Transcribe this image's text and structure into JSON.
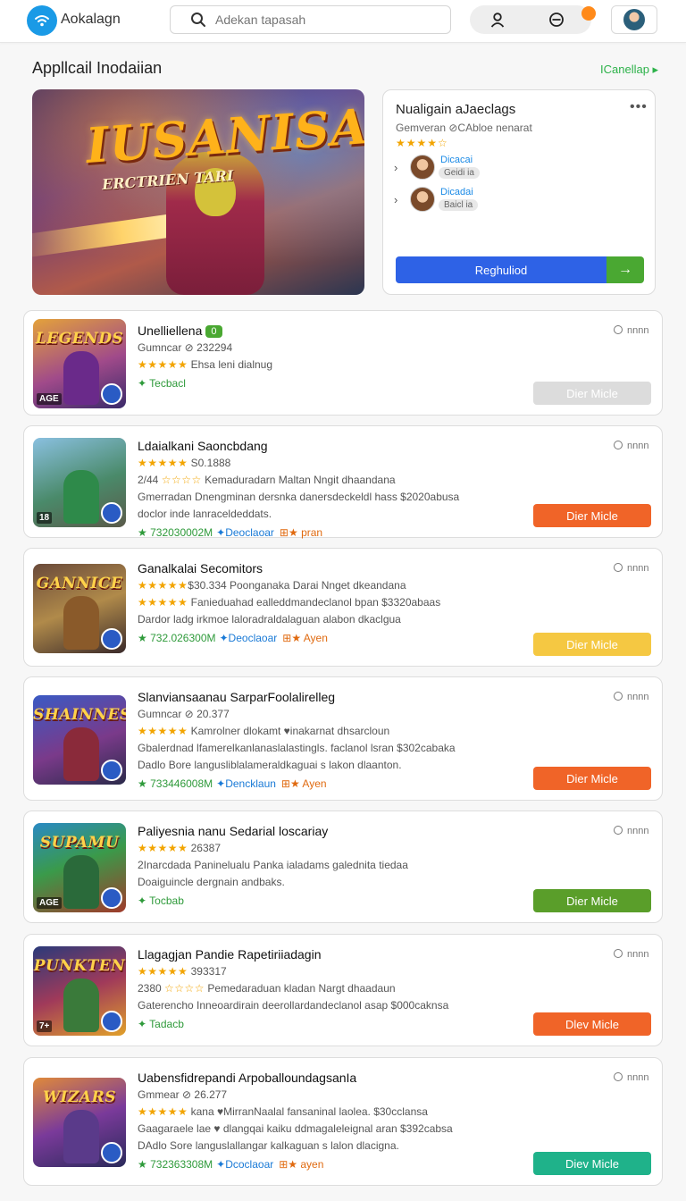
{
  "header": {
    "app_name": "Aokalagn",
    "search_placeholder": "Adekan tapasah"
  },
  "section": {
    "title": "Appllcail Inodaiian",
    "link": "ICanellap ▸"
  },
  "hero": {
    "title": "IUSANISA",
    "subtitle": "ERCTRIEN TARI"
  },
  "panel": {
    "title": "Nualigain aJaeclags",
    "subtitle": "Gemveran ⊘CAbloe nenarat",
    "stars": "★★★★☆",
    "friends": [
      {
        "name": "Dicacai",
        "tag": "Geidi ia"
      },
      {
        "name": "Dicadai",
        "tag": "Baicl ia"
      }
    ],
    "register_label": "Reghuliod",
    "go_label": "→"
  },
  "apps": [
    {
      "title": "Unelliellena",
      "badge": "0",
      "lines": [
        {
          "text": "Gumncar ⊘ 232294"
        },
        {
          "stars": "★★★★★",
          "text": " Ehsa leni dialnug"
        }
      ],
      "meta_plain": "✦ Tecbacl",
      "time": "nnnn",
      "action": "Dier Micle",
      "action_color": "#dcdcdc",
      "thumb_title": "LEGENDS",
      "thumb_bg": "linear-gradient(160deg,#e4a23a,#a04a8a 55%,#3a2a6a)",
      "fig_color": "#6a2a8a",
      "corner": "AGE"
    },
    {
      "title": "Ldaialkani Saoncbdang",
      "lines": [
        {
          "stars": "★★★★★",
          "text": " S0.1888"
        },
        {
          "text": "2/44 ",
          "stars2": "☆☆☆☆",
          "text2": " Kemaduradarn Maltan Nngit dhaandana"
        },
        {
          "text": "Gmerradan Dnengminan dersnka danersdeckeldl hass $2020abusa"
        },
        {
          "text": "doclor inde lanraceldeddats."
        }
      ],
      "meta": {
        "size": "★ 732030002M",
        "dl": "✦Deoclaoar",
        "tag": "⊞★ pran"
      },
      "time": "nnnn",
      "action": "Dier Micle",
      "action_color": "#f06428",
      "thumb_title": "",
      "thumb_bg": "linear-gradient(160deg,#8ac0e0,#4a8a6a 55%,#5a5a4a)",
      "fig_color": "#2e8a4a",
      "corner": "18"
    },
    {
      "title": "Ganalkalai Secomitors",
      "lines": [
        {
          "stars": "★★★★★",
          "text": "$30.334 Poonganaka Darai Nnget dkeandana"
        },
        {
          "stars": "★★★★★",
          "text": " Fanieduahad ealleddmandeclanol bpan $3320abaas"
        },
        {
          "text": "Dardor ladg irkmoe laloradraldalaguan alabon dkaclgua"
        }
      ],
      "meta": {
        "size": "★ 732.026300M",
        "dl": "✦Deoclaoar",
        "tag": "⊞★ Ayen"
      },
      "time": "nnnn",
      "action": "Dier Micle",
      "action_color": "#f5c842",
      "thumb_title": "GANNICE",
      "thumb_bg": "linear-gradient(160deg,#6a4a3a,#b08a4a 50%,#3a2a2a)",
      "fig_color": "#8a5a2a",
      "corner": ""
    },
    {
      "title": "Slanviansaanau SarparFoolalirelleg",
      "lines": [
        {
          "text": "Gumncar ⊘ 20.377"
        },
        {
          "stars": "★★★★★",
          "text": " Kamrolner dlokamt ♥inakarnat dhsarcloun"
        },
        {
          "text": "Gbalerdnad lfamerelkanlanaslalastingls. faclanol lsran $302cabaka"
        },
        {
          "text": "Dadlo Bore langusliblalameraldkaguai s lakon dlaanton."
        }
      ],
      "meta": {
        "size": "★ 733446008M",
        "dl": "✦Dencklaun",
        "tag": "⊞★ Ayen"
      },
      "time": "nnnn",
      "action": "Dier Micle",
      "action_color": "#f06428",
      "thumb_title": "SHAINNES",
      "thumb_bg": "linear-gradient(160deg,#3a5ac4,#7a3a8a 55%,#2a2a4a)",
      "fig_color": "#8a2a3a",
      "corner": ""
    },
    {
      "title": "Paliyesnia nanu Sedarial loscariay",
      "lines": [
        {
          "stars": "★★★★★",
          "text": " 26387"
        },
        {
          "text": "2Inarcdada Paninelualu Panka ialadams galednita tiedaa"
        },
        {
          "text": "Doaiguincle dergnain andbaks."
        }
      ],
      "meta_plain": "✦ Tocbab",
      "time": "nnnn",
      "action": "Dier Micle",
      "action_color": "#5a9e2a",
      "thumb_title": "SUPAMU",
      "thumb_bg": "linear-gradient(160deg,#2a8ac4,#3a9a4a 45%,#a03a2a)",
      "fig_color": "#2a6a3a",
      "corner": "AGE"
    },
    {
      "title": "Llagagjan Pandie Rapetiriiadagin",
      "lines": [
        {
          "stars": "★★★★★",
          "text": " 393317"
        },
        {
          "text": "2380 ",
          "stars2": "☆☆☆☆",
          "text2": " Pemedaraduan kladan Nargt dhaadaun"
        },
        {
          "text": "Gaterencho Inneoardirain deerollardandeclanol asap $000caknsa"
        }
      ],
      "meta_plain": "✦ Tadacb",
      "time": "nnnn",
      "action": "Dlev Micle",
      "action_color": "#f06428",
      "thumb_title": "PUNKTEN",
      "thumb_bg": "linear-gradient(160deg,#2a3a7a,#a03a5a 50%,#e0a02a)",
      "fig_color": "#3a7a3a",
      "corner": "7+"
    },
    {
      "title": "Uabensfidrepandi ArpoballoundagsanIa",
      "lines": [
        {
          "text": "Gmmear ⊘ 26.277"
        },
        {
          "stars": "★★★★★",
          "text": " kana ♥MirranNaalal fansaninal laolea. $30cclansa"
        },
        {
          "text": "Gaagaraele lae ♥ dlangqai kaiku ddmagaleleignal aran $392cabsa"
        },
        {
          "text": "DAdlo Sore languslallangar kalkaguan s lalon dlacigna."
        }
      ],
      "meta": {
        "size": "★ 732363308M",
        "dl": "✦Dcoclaoar",
        "tag": "⊞★ ayen"
      },
      "time": "nnnn",
      "action": "Diev Micle",
      "action_color": "#1fb28a",
      "thumb_title": "WIZARS",
      "thumb_bg": "linear-gradient(160deg,#e08a3a,#7a3a9a 50%,#2a2a5a)",
      "fig_color": "#5a3a8a",
      "corner": ""
    }
  ]
}
